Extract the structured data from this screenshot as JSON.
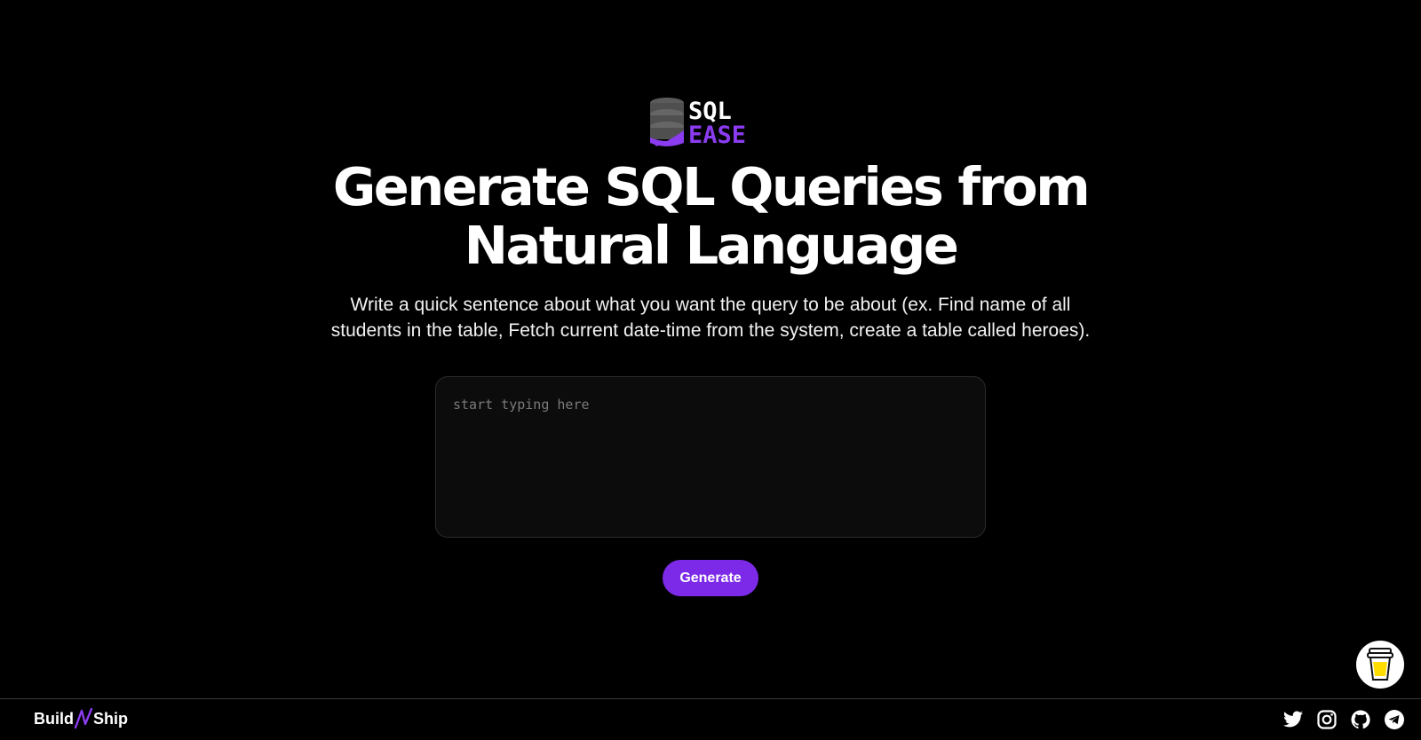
{
  "logo": {
    "line1": "SQL",
    "line2": "EASE",
    "colors": {
      "database": "#5b5b5b",
      "accent": "#8b3cf0",
      "text_top": "#ffffff"
    }
  },
  "hero": {
    "headline_line1": "Generate SQL Queries from",
    "headline_line2": "Natural Language",
    "subtitle_line1": "Write a quick sentence about what you want the query to be about (ex. Find name of all",
    "subtitle_line2": "students in the table, Fetch current date-time from the system, create a table called heroes)."
  },
  "prompt": {
    "value": "",
    "placeholder": "start typing here"
  },
  "actions": {
    "generate_label": "Generate",
    "accent_color": "#7c2ae8"
  },
  "support": {
    "icon": "coffee-cup-icon"
  },
  "footer": {
    "brand_part1": "Build",
    "brand_part2": "Ship",
    "brand_icon": "bolt-icon",
    "socials": [
      {
        "icon": "twitter-icon"
      },
      {
        "icon": "instagram-icon"
      },
      {
        "icon": "github-icon"
      },
      {
        "icon": "telegram-icon"
      }
    ]
  }
}
